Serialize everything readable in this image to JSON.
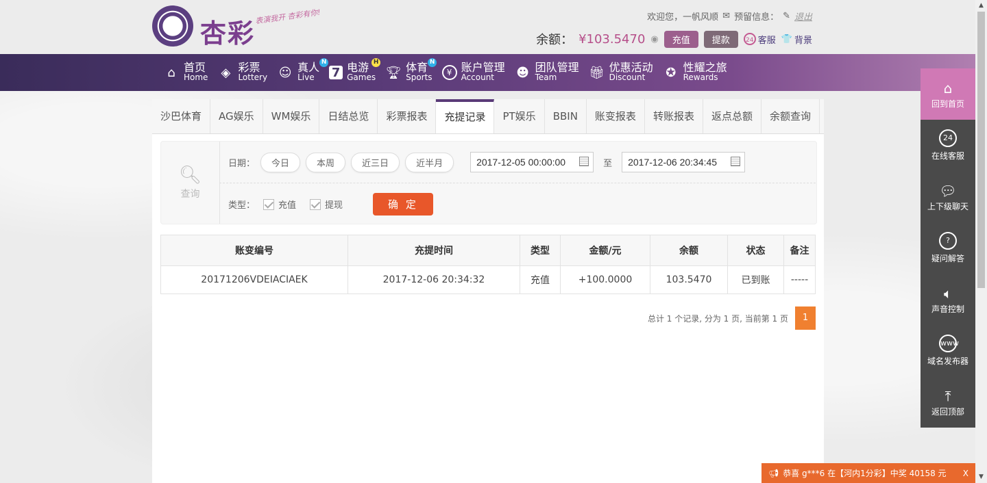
{
  "header": {
    "logo_text": "杏彩",
    "slogan": "表演我开 杏彩有你!",
    "welcome": "欢迎您，一帆风顺",
    "message": "预留信息：",
    "logout": "退出",
    "balance_label": "余额：",
    "balance_value": "¥103.5470",
    "deposit": "充值",
    "withdraw": "提款",
    "service": "客服",
    "background": "背景"
  },
  "nav": [
    {
      "cn": "首页",
      "en": "Home",
      "icon": "home-icon",
      "badge": ""
    },
    {
      "cn": "彩票",
      "en": "Lottery",
      "icon": "lottery-icon",
      "badge": ""
    },
    {
      "cn": "真人",
      "en": "Live",
      "icon": "live-icon",
      "badge": "N"
    },
    {
      "cn": "电游",
      "en": "Games",
      "icon": "games-icon",
      "badge": "H"
    },
    {
      "cn": "体育",
      "en": "Sports",
      "icon": "trophy-icon",
      "badge": "N"
    },
    {
      "cn": "账户管理",
      "en": "Account",
      "icon": "yen-icon",
      "badge": ""
    },
    {
      "cn": "团队管理",
      "en": "Team",
      "icon": "team-icon",
      "badge": ""
    },
    {
      "cn": "优惠活动",
      "en": "Discount",
      "icon": "gift-icon",
      "badge": ""
    },
    {
      "cn": "性耀之旅",
      "en": "Rewards",
      "icon": "rewards-icon",
      "badge": ""
    }
  ],
  "tabs": [
    "沙巴体育",
    "AG娱乐",
    "WM娱乐",
    "日结总览",
    "彩票报表",
    "充提记录",
    "PT娱乐",
    "BBIN",
    "账变报表",
    "转账报表",
    "返点总额",
    "余额查询"
  ],
  "active_tab": "充提记录",
  "query": {
    "label": "查询",
    "date_label": "日期：",
    "quick": [
      "今日",
      "本周",
      "近三日",
      "近半月"
    ],
    "start": "2017-12-05 00:00:00",
    "to": "至",
    "end": "2017-12-06 20:34:45",
    "type_label": "类型：",
    "type_deposit": "充值",
    "type_withdraw": "提现",
    "confirm": "确 定"
  },
  "table": {
    "headers": [
      "账变编号",
      "充提时间",
      "类型",
      "金额/元",
      "余额",
      "状态",
      "备注"
    ],
    "rows": [
      [
        "20171206VDEIACIAEK",
        "2017-12-06 20:34:32",
        "充值",
        "+100.0000",
        "103.5470",
        "已到账",
        "-----"
      ]
    ]
  },
  "pager": {
    "summary": "总计 1 个记录, 分为 1 页, 当前第 1 页",
    "page": "1"
  },
  "sidebar": [
    {
      "label": "回到首页",
      "icon": "home-icon"
    },
    {
      "label": "在线客服",
      "icon": "support-24-icon"
    },
    {
      "label": "上下级聊天",
      "icon": "chat-icon"
    },
    {
      "label": "疑问解答",
      "icon": "question-icon"
    },
    {
      "label": "声音控制",
      "icon": "speaker-icon"
    },
    {
      "label": "域名发布器",
      "icon": "www-icon"
    },
    {
      "label": "返回顶部",
      "icon": "back-to-top-icon"
    }
  ],
  "ticker": {
    "text": "恭喜 g***6 在【河内1分彩】中奖 40158 元",
    "close": "X"
  }
}
